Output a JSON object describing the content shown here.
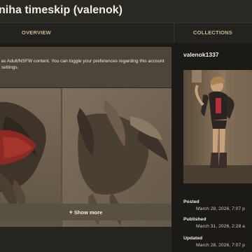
{
  "header": {
    "title": "niha timeskip (valenok)"
  },
  "tabs": [
    {
      "label": "OVERVIEW"
    },
    {
      "label": "COLLECTIONS"
    }
  ],
  "notice": {
    "text": "d as Adult/NSFW content. You can toggle your preferences regarding this account settings."
  },
  "gallery": {
    "show_more_label": "Show more",
    "show_more_icon": "plus-icon"
  },
  "sidebar": {
    "uploader": "valenok1337",
    "meta": [
      {
        "label": "Posted",
        "value": "March 28, 2026, 7:07 p"
      },
      {
        "label": "Published",
        "value": "March 31, 2026, 2:28 a"
      },
      {
        "label": "Updated",
        "value": "March 28, 2026, 7:07 p"
      }
    ]
  },
  "colors": {
    "accent": "#c8b98d",
    "background": "#1c1a17",
    "panel": "#2b2924",
    "notice": "#4d4539",
    "button": "#585040"
  }
}
